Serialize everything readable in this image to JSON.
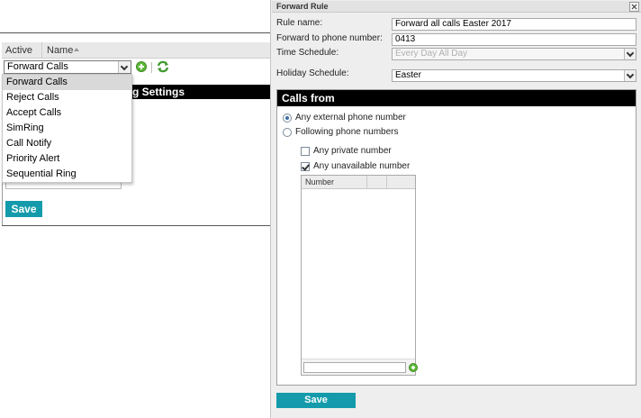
{
  "left": {
    "grid_header": {
      "active_label": "Active",
      "name_label": "Name"
    },
    "toolbar": {
      "combo_value": "Forward Calls"
    },
    "settings_bar_title": "g Settings",
    "save_label": "Save"
  },
  "dropdown": {
    "options": [
      "Forward Calls",
      "Reject Calls",
      "Accept Calls",
      "SimRing",
      "Call Notify",
      "Priority Alert",
      "Sequential Ring"
    ],
    "selected_index": 0
  },
  "dialog": {
    "title": "Forward Rule",
    "fields": {
      "rule_name_label": "Rule name:",
      "rule_name_value": "Forward all calls Easter 2017",
      "forward_label": "Forward to phone number:",
      "forward_value": "0413",
      "time_schedule_label": "Time Schedule:",
      "time_schedule_value": "Every Day All Day",
      "holiday_schedule_label": "Holiday Schedule:",
      "holiday_schedule_value": "Easter"
    },
    "calls_from": {
      "title": "Calls from",
      "any_external": "Any external phone number",
      "following": "Following phone numbers",
      "any_private": "Any private number",
      "any_unavailable": "Any unavailable number",
      "number_column": "Number"
    },
    "save_label": "Save"
  },
  "colors": {
    "save_button": "#139bab",
    "header_bar": "#000000",
    "add_icon": "#5fb83a"
  }
}
